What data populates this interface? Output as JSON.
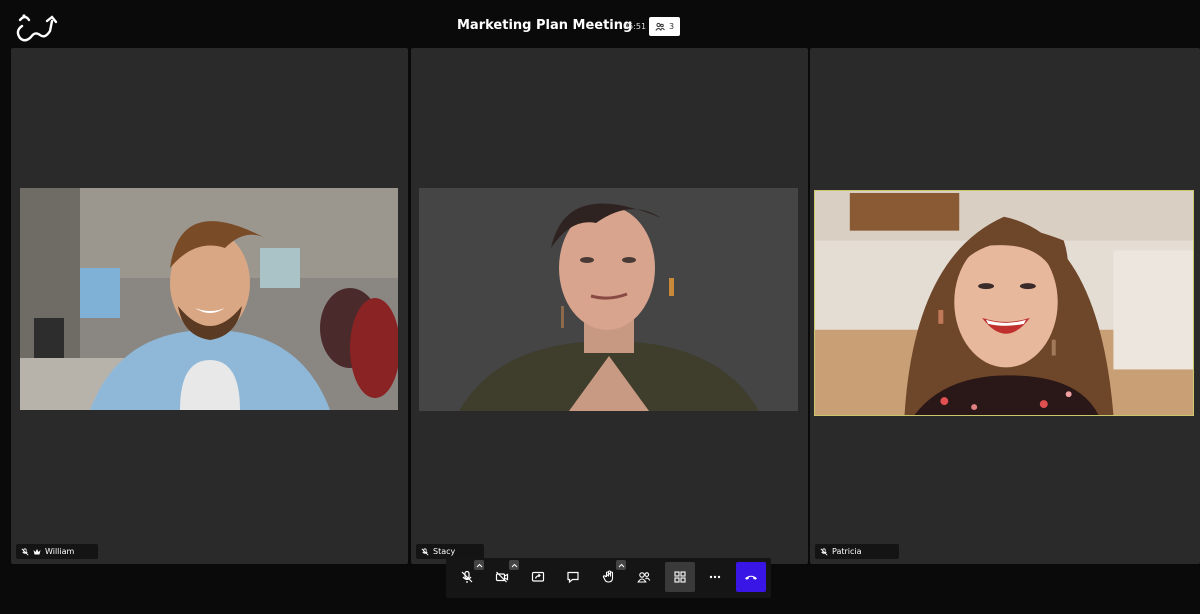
{
  "meeting": {
    "title": "Marketing Plan Meeting",
    "elapsed": "05:51",
    "participant_count": "3"
  },
  "participants": [
    {
      "name": "William",
      "mic": "muted",
      "role_icon": "crown-icon"
    },
    {
      "name": "Stacy",
      "mic": "muted"
    },
    {
      "name": "Patricia",
      "mic": "muted"
    }
  ],
  "controls": [
    {
      "id": "mic",
      "icon": "mic-off-icon",
      "has_menu": true
    },
    {
      "id": "camera",
      "icon": "camera-off-icon",
      "has_menu": true
    },
    {
      "id": "share-screen",
      "icon": "share-screen-icon"
    },
    {
      "id": "chat",
      "icon": "chat-icon"
    },
    {
      "id": "raise-hand",
      "icon": "hand-icon",
      "has_menu": true
    },
    {
      "id": "participants",
      "icon": "participants-icon"
    },
    {
      "id": "tile-view",
      "icon": "grid-icon",
      "active": true
    },
    {
      "id": "more",
      "icon": "more-icon"
    },
    {
      "id": "hangup",
      "icon": "hangup-icon"
    }
  ],
  "colors": {
    "hangup": "#3a16e6",
    "tile_bg": "#2a2a2a",
    "highlight_border": "#c9c86a"
  }
}
